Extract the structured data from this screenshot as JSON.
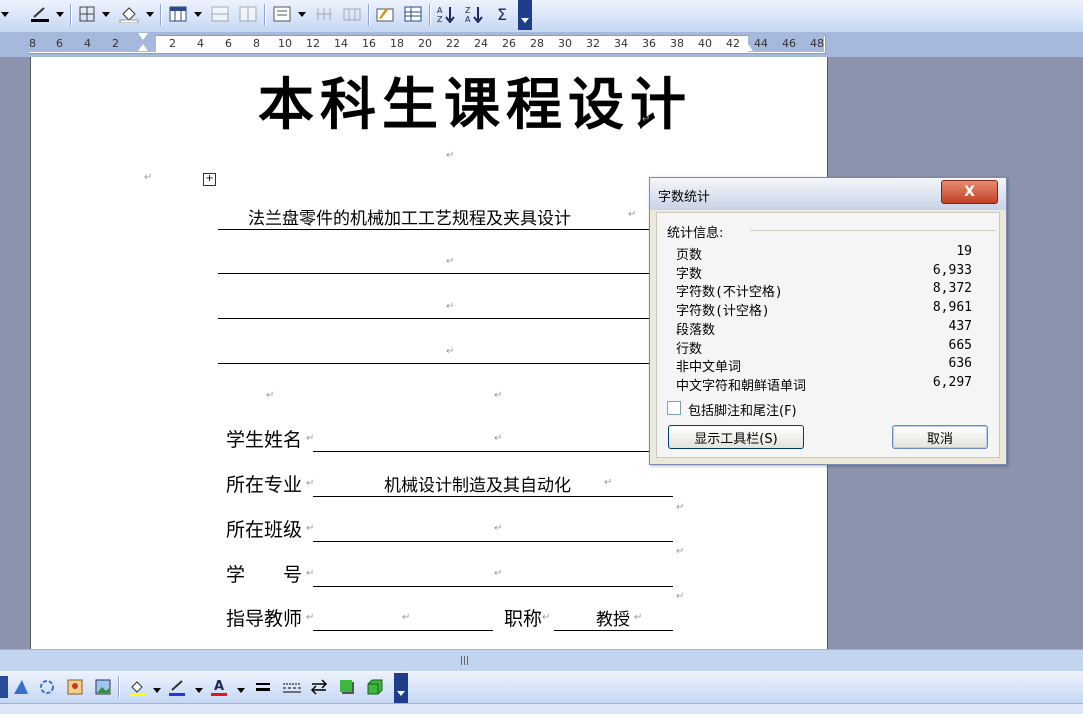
{
  "ruler": {
    "numbers": [
      "8",
      "6",
      "4",
      "2",
      "2",
      "4",
      "6",
      "8",
      "10",
      "12",
      "14",
      "16",
      "18",
      "20",
      "22",
      "24",
      "26",
      "28",
      "30",
      "32",
      "34",
      "36",
      "38",
      "40",
      "42",
      "44",
      "46",
      "48"
    ]
  },
  "toolbar": {
    "sum_label": "Σ"
  },
  "document": {
    "title": "本科生课程设计",
    "project_line": "法兰盘零件的机械加工工艺规程及夹具设计",
    "fields": {
      "student_name_label": "学生姓名",
      "major_label": "所在专业",
      "major_value": "机械设计制造及其自动化",
      "class_label": "所在班级",
      "id_label": "学　　号",
      "advisor_label": "指导教师",
      "title_label": "职称",
      "title_value": "教授"
    }
  },
  "dialog": {
    "title": "字数统计",
    "section": "统计信息:",
    "stats": [
      {
        "label": "页数",
        "value": "19"
      },
      {
        "label": "字数",
        "value": "6,933"
      },
      {
        "label": "字符数(不计空格)",
        "value": "8,372"
      },
      {
        "label": "字符数(计空格)",
        "value": "8,961"
      },
      {
        "label": "段落数",
        "value": "437"
      },
      {
        "label": "行数",
        "value": "665"
      },
      {
        "label": "非中文单词",
        "value": "636"
      },
      {
        "label": "中文字符和朝鲜语单词",
        "value": "6,297"
      }
    ],
    "checkbox_label": "包括脚注和尾注(F)",
    "toolbar_button": "显示工具栏(S)",
    "cancel_button": "取消",
    "close_label": "X"
  },
  "colors": {
    "title_bar": "#d8e0ee",
    "close_btn": "#c94a36",
    "page_bg": "#ffffff",
    "app_bg": "#8b94ac"
  }
}
